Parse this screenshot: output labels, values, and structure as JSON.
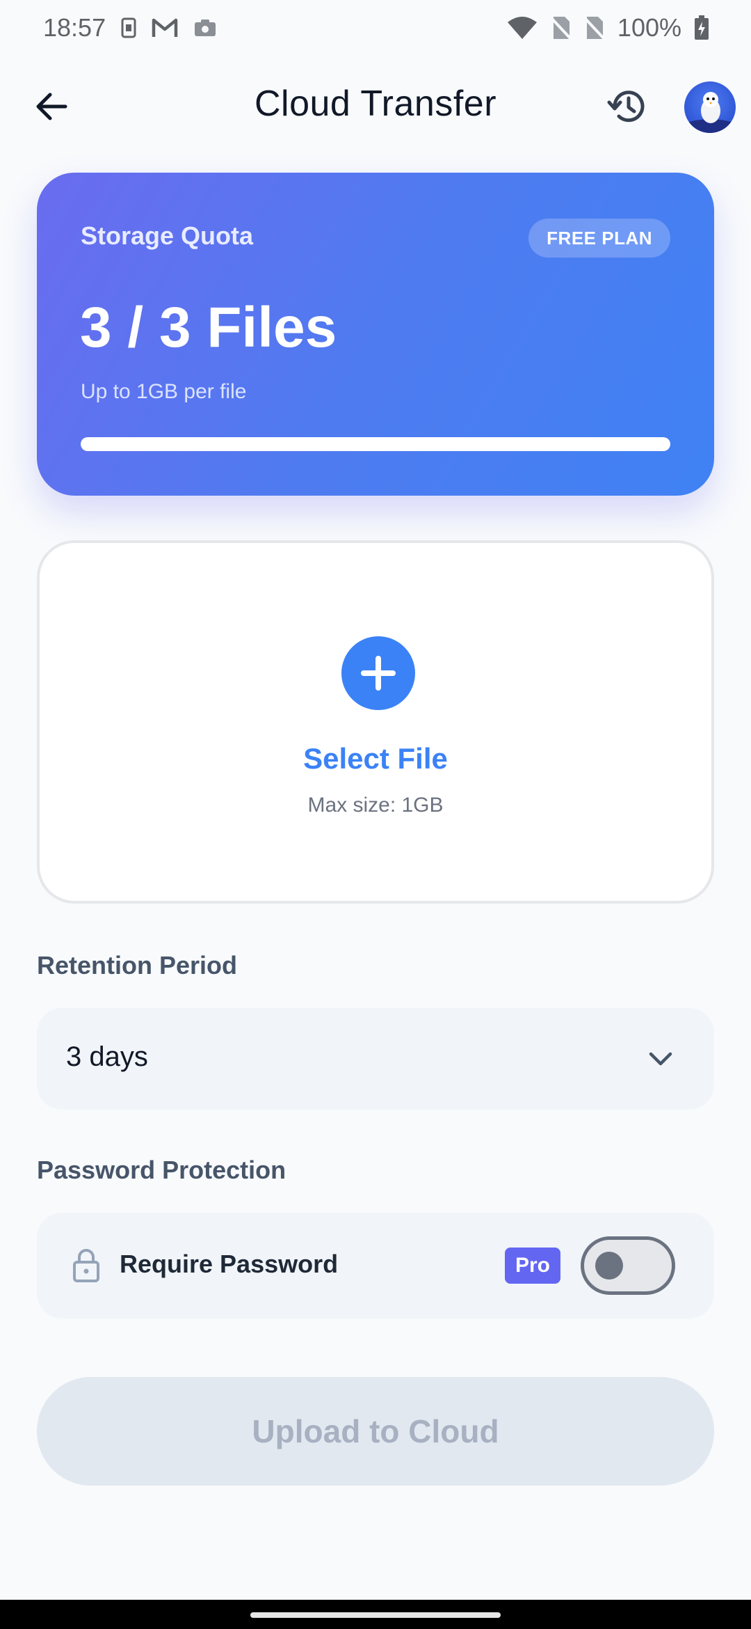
{
  "status_bar": {
    "time": "18:57",
    "battery": "100%",
    "icons": [
      "sim-card-icon",
      "gmail-icon",
      "camera-icon",
      "wifi-icon",
      "no-sim-icon",
      "no-sim-icon",
      "battery-charging-icon"
    ]
  },
  "header": {
    "title": "Cloud Transfer",
    "back_icon": "arrow-left-icon",
    "history_icon": "history-icon",
    "avatar_icon": "owl-avatar-icon"
  },
  "quota": {
    "label": "Storage Quota",
    "plan": "FREE PLAN",
    "value": "3 / 3 Files",
    "subtitle": "Up to 1GB per file",
    "progress_fraction": 1.0
  },
  "upload_area": {
    "title": "Select File",
    "subtitle": "Max size: 1GB",
    "icon": "plus-icon"
  },
  "retention": {
    "label": "Retention Period",
    "selected": "3 days"
  },
  "password": {
    "label": "Password Protection",
    "option_label": "Require Password",
    "badge": "Pro",
    "enabled": false
  },
  "actions": {
    "upload_label": "Upload to Cloud"
  },
  "colors": {
    "accent": "#3b82f6",
    "gradient_start": "#6a6cef",
    "gradient_end": "#3f82f4",
    "pro_badge": "#6366f1",
    "disabled_button": "#e2e8f0"
  }
}
